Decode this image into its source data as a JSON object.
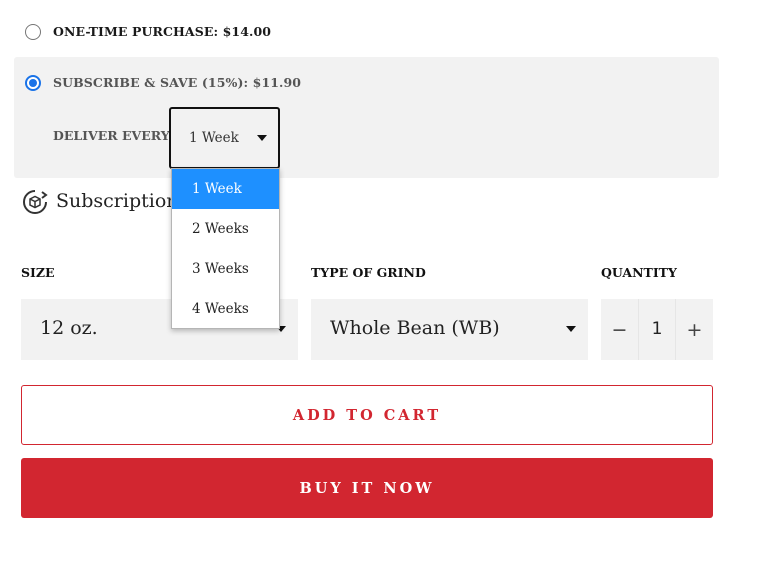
{
  "purchase_options": {
    "one_time": {
      "label": "ONE-TIME PURCHASE: $14.00",
      "selected": false
    },
    "subscribe": {
      "label": "SUBSCRIBE & SAVE (15%): $11.90",
      "selected": true
    }
  },
  "delivery": {
    "label": "DELIVER EVERY",
    "selected": "1 Week",
    "options": [
      "1 Week",
      "2 Weeks",
      "3 Weeks",
      "4 Weeks"
    ],
    "dropdown_open": true
  },
  "subscription_info": {
    "label": "Subscription",
    "icon": "subscription-box-icon"
  },
  "size": {
    "label": "SIZE",
    "value": "12 oz."
  },
  "grind": {
    "label": "TYPE OF GRIND",
    "value": "Whole Bean (WB)"
  },
  "quantity": {
    "label": "QUANTITY",
    "value": "1",
    "minus": "−",
    "plus": "+"
  },
  "actions": {
    "add_to_cart": "ADD TO CART",
    "buy_now": "BUY IT NOW"
  },
  "colors": {
    "brand_red": "#d22630",
    "radio_blue": "#1a73e8",
    "highlight": "#1e90ff",
    "panel_bg": "#f2f2f2"
  }
}
